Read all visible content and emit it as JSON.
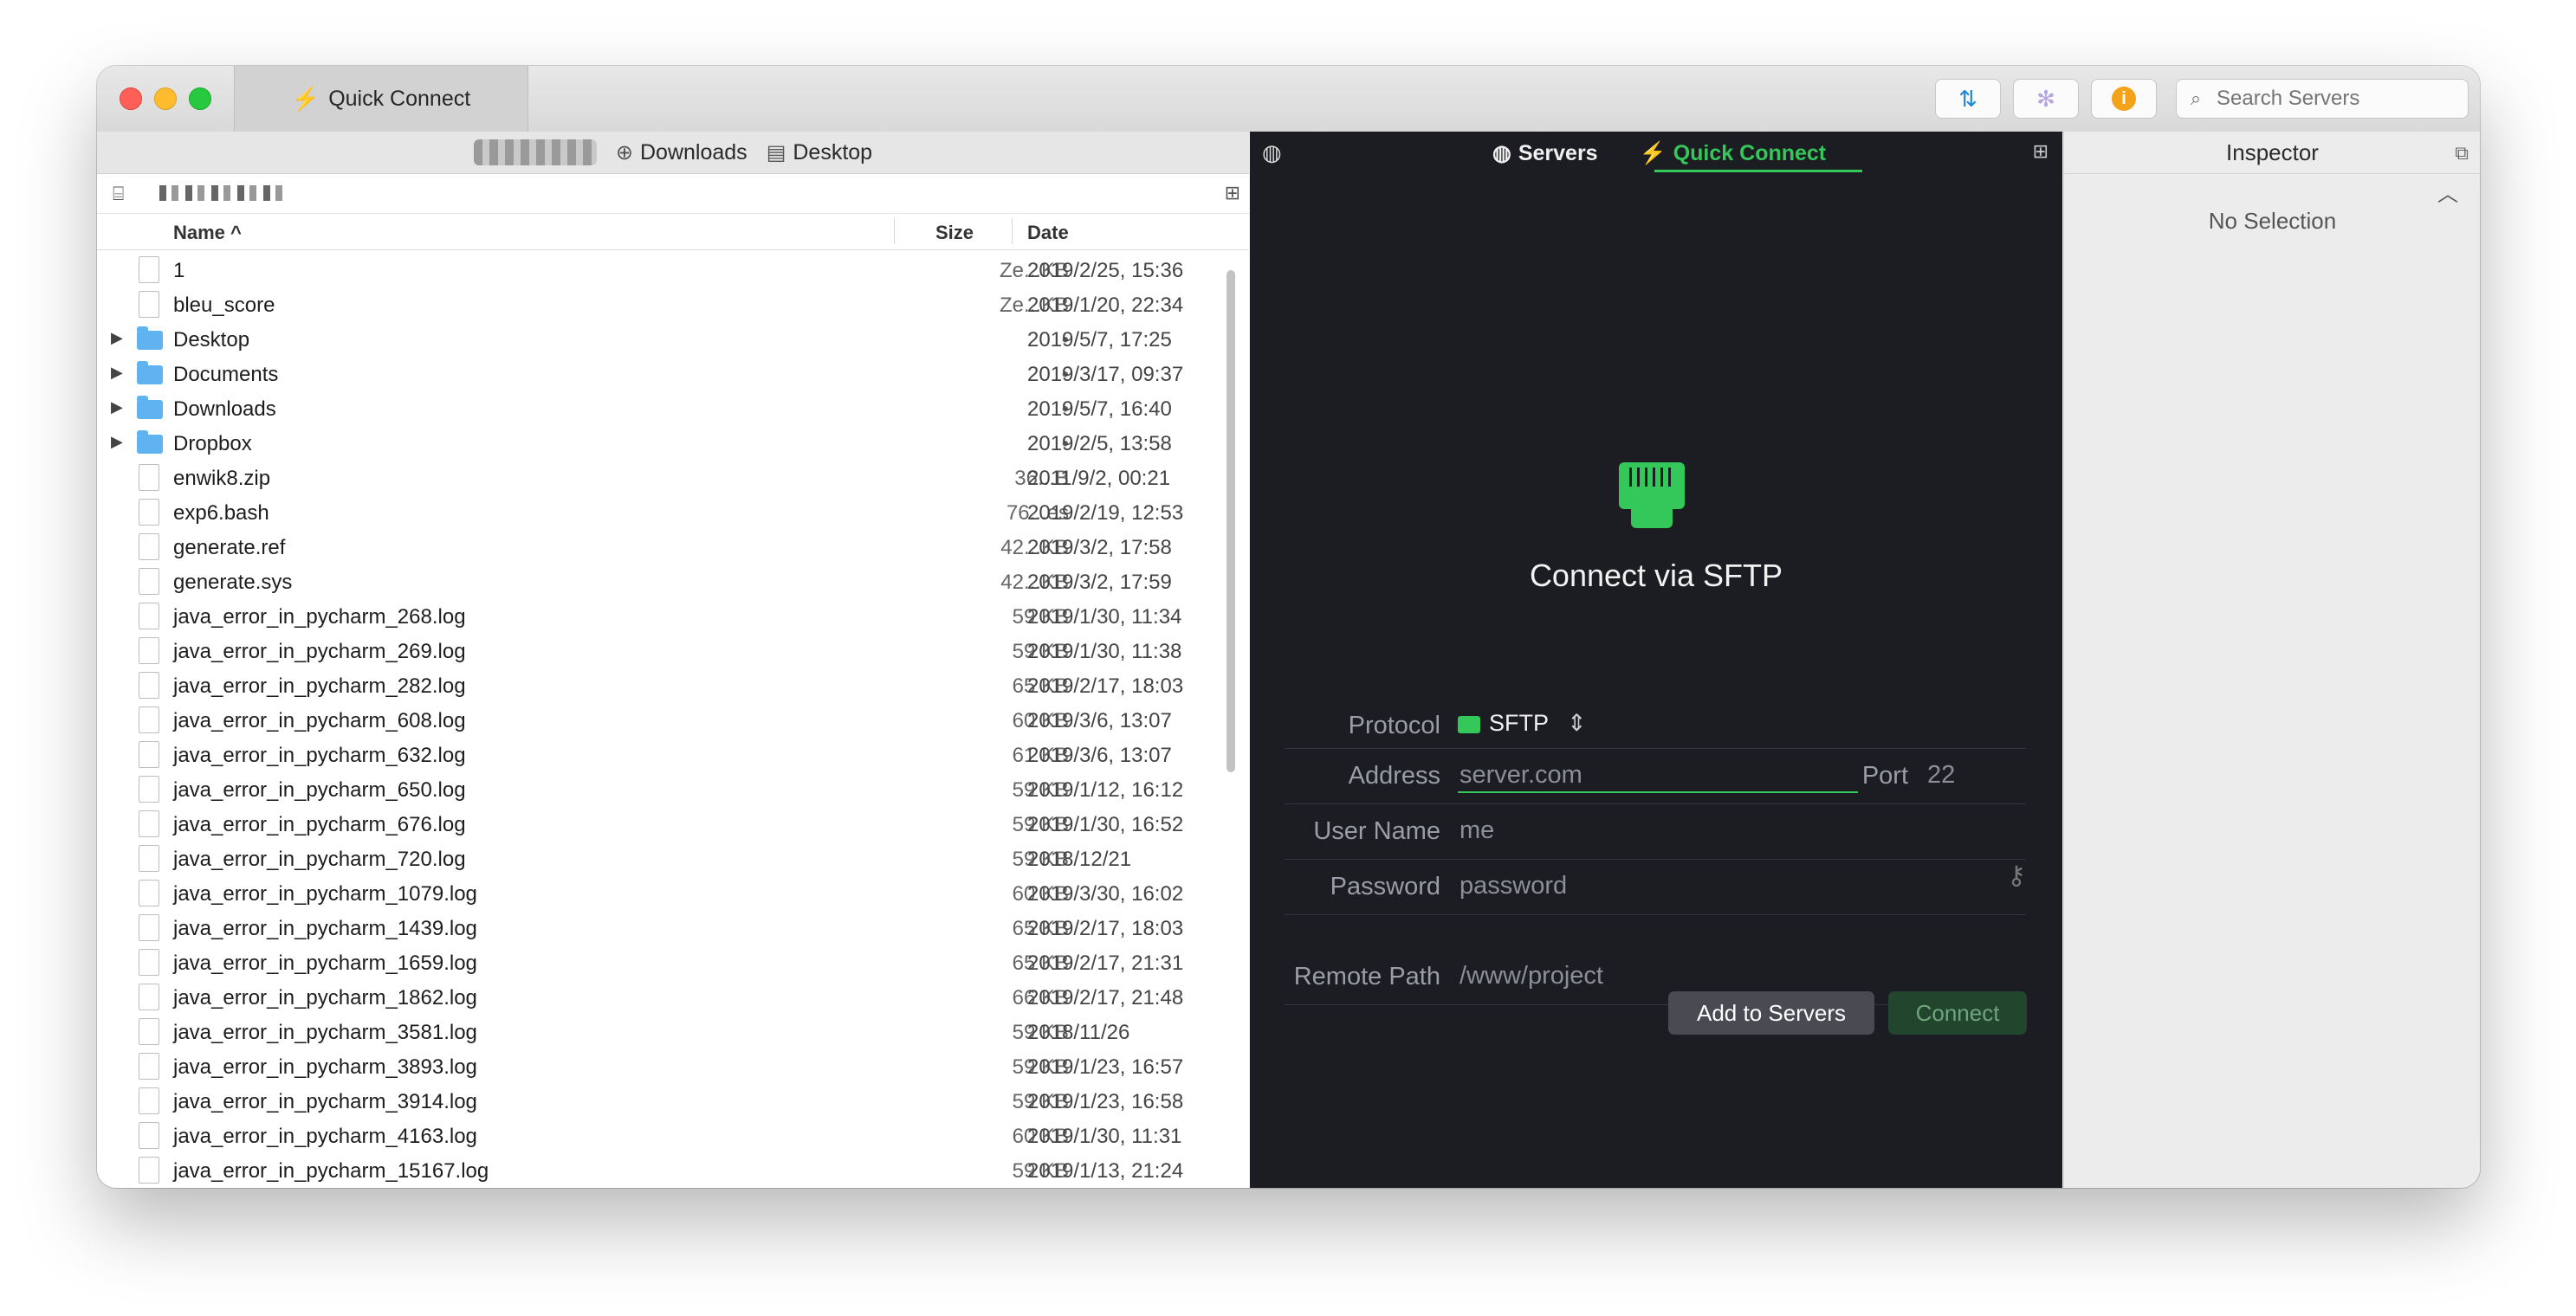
{
  "window": {
    "tab_title": "Quick Connect",
    "search_placeholder": "Search Servers"
  },
  "path_bar": {
    "items": [
      "Downloads",
      "Desktop"
    ]
  },
  "file_list": {
    "columns": {
      "name": "Name ^",
      "size": "Size",
      "date": "Date"
    },
    "rows": [
      {
        "name": "1",
        "size": "Ze...KB",
        "date": "2019/2/25, 15:36",
        "kind": "file"
      },
      {
        "name": "bleu_score",
        "size": "Ze...KB",
        "date": "2019/1/20, 22:34",
        "kind": "file"
      },
      {
        "name": "Desktop",
        "size": "•",
        "date": "2019/5/7, 17:25",
        "kind": "folder"
      },
      {
        "name": "Documents",
        "size": "•",
        "date": "2019/3/17, 09:37",
        "kind": "folder"
      },
      {
        "name": "Downloads",
        "size": "•",
        "date": "2019/5/7, 16:40",
        "kind": "folder"
      },
      {
        "name": "Dropbox",
        "size": "•",
        "date": "2019/2/5, 13:58",
        "kind": "folder"
      },
      {
        "name": "enwik8.zip",
        "size": "36...B",
        "date": "2011/9/2, 00:21",
        "kind": "file"
      },
      {
        "name": "exp6.bash",
        "size": "76...es",
        "date": "2019/2/19, 12:53",
        "kind": "file"
      },
      {
        "name": "generate.ref",
        "size": "42...KB",
        "date": "2019/3/2, 17:58",
        "kind": "file"
      },
      {
        "name": "generate.sys",
        "size": "42...KB",
        "date": "2019/3/2, 17:59",
        "kind": "file"
      },
      {
        "name": "java_error_in_pycharm_268.log",
        "size": "59 KB",
        "date": "2019/1/30, 11:34",
        "kind": "file"
      },
      {
        "name": "java_error_in_pycharm_269.log",
        "size": "59 KB",
        "date": "2019/1/30, 11:38",
        "kind": "file"
      },
      {
        "name": "java_error_in_pycharm_282.log",
        "size": "65 KB",
        "date": "2019/2/17, 18:03",
        "kind": "file"
      },
      {
        "name": "java_error_in_pycharm_608.log",
        "size": "60 KB",
        "date": "2019/3/6, 13:07",
        "kind": "file"
      },
      {
        "name": "java_error_in_pycharm_632.log",
        "size": "61 KB",
        "date": "2019/3/6, 13:07",
        "kind": "file"
      },
      {
        "name": "java_error_in_pycharm_650.log",
        "size": "59 KB",
        "date": "2019/1/12, 16:12",
        "kind": "file"
      },
      {
        "name": "java_error_in_pycharm_676.log",
        "size": "59 KB",
        "date": "2019/1/30, 16:52",
        "kind": "file"
      },
      {
        "name": "java_error_in_pycharm_720.log",
        "size": "59 KB",
        "date": "2018/12/21",
        "kind": "file"
      },
      {
        "name": "java_error_in_pycharm_1079.log",
        "size": "60 KB",
        "date": "2019/3/30, 16:02",
        "kind": "file"
      },
      {
        "name": "java_error_in_pycharm_1439.log",
        "size": "65 KB",
        "date": "2019/2/17, 18:03",
        "kind": "file"
      },
      {
        "name": "java_error_in_pycharm_1659.log",
        "size": "65 KB",
        "date": "2019/2/17, 21:31",
        "kind": "file"
      },
      {
        "name": "java_error_in_pycharm_1862.log",
        "size": "66 KB",
        "date": "2019/2/17, 21:48",
        "kind": "file"
      },
      {
        "name": "java_error_in_pycharm_3581.log",
        "size": "59 KB",
        "date": "2018/11/26",
        "kind": "file"
      },
      {
        "name": "java_error_in_pycharm_3893.log",
        "size": "59 KB",
        "date": "2019/1/23, 16:57",
        "kind": "file"
      },
      {
        "name": "java_error_in_pycharm_3914.log",
        "size": "59 KB",
        "date": "2019/1/23, 16:58",
        "kind": "file"
      },
      {
        "name": "java_error_in_pycharm_4163.log",
        "size": "60 KB",
        "date": "2019/1/30, 11:31",
        "kind": "file"
      },
      {
        "name": "java_error_in_pycharm_15167.log",
        "size": "59 KB",
        "date": "2019/1/13, 21:24",
        "kind": "file"
      }
    ]
  },
  "remote": {
    "tabs": {
      "servers": "Servers",
      "quick_connect": "Quick Connect"
    },
    "heading": "Connect via SFTP",
    "protocol": {
      "label": "Protocol",
      "value": "SFTP"
    },
    "address": {
      "label": "Address",
      "placeholder": "server.com"
    },
    "port": {
      "label": "Port",
      "placeholder": "22"
    },
    "username": {
      "label": "User Name",
      "placeholder": "me"
    },
    "password": {
      "label": "Password",
      "placeholder": "password"
    },
    "remote_path": {
      "label": "Remote Path",
      "placeholder": "/www/project"
    },
    "buttons": {
      "add": "Add to Servers",
      "connect": "Connect"
    },
    "accent_color": "#34c759"
  },
  "inspector": {
    "title": "Inspector",
    "empty_text": "No Selection"
  }
}
